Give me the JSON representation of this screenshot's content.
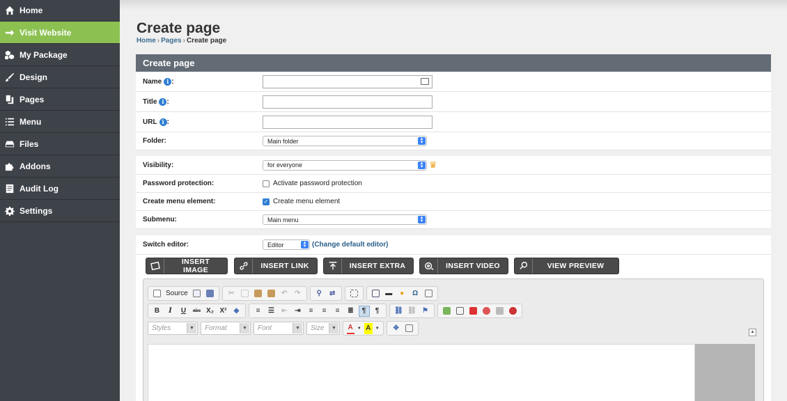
{
  "sidebar": {
    "items": [
      {
        "label": "Home",
        "icon": "home-icon"
      },
      {
        "label": "Visit Website",
        "icon": "arrow-right-icon",
        "active": true
      },
      {
        "label": "My Package",
        "icon": "cubes-icon"
      },
      {
        "label": "Design",
        "icon": "brush-icon"
      },
      {
        "label": "Pages",
        "icon": "copy-icon"
      },
      {
        "label": "Menu",
        "icon": "list-icon"
      },
      {
        "label": "Files",
        "icon": "drive-icon"
      },
      {
        "label": "Addons",
        "icon": "puzzle-icon"
      },
      {
        "label": "Audit Log",
        "icon": "document-icon"
      },
      {
        "label": "Settings",
        "icon": "gear-icon"
      }
    ],
    "active_color": "#8cc152",
    "bg_color": "#3e4249"
  },
  "header": {
    "title": "Create page",
    "breadcrumb": [
      "Home",
      "Pages",
      "Create page"
    ]
  },
  "panel": {
    "title": "Create page",
    "fields": {
      "name_label": "Name",
      "title_label": "Title",
      "url_label": "URL",
      "colon": ":",
      "folder_label": "Folder:",
      "folder_value": "Main folder",
      "visibility_label": "Visibility:",
      "visibility_value": "for everyone",
      "password_label": "Password protection:",
      "password_option": "Activate password protection",
      "password_checked": false,
      "menu_label": "Create menu element:",
      "menu_option": "Create menu element",
      "menu_checked": true,
      "submenu_label": "Submenu:",
      "submenu_value": "Main menu",
      "editor_label": "Switch editor:",
      "editor_value": "Editor",
      "editor_link": "(Change default editor)"
    },
    "insert_buttons": [
      {
        "label": "INSERT IMAGE",
        "icon": "image-icon"
      },
      {
        "label": "INSERT LINK",
        "icon": "link-icon"
      },
      {
        "label": "INSERT EXTRA",
        "icon": "upload-icon"
      },
      {
        "label": "INSERT VIDEO",
        "icon": "film-icon"
      },
      {
        "label": "VIEW PREVIEW",
        "icon": "search-icon"
      }
    ],
    "editor": {
      "source_label": "Source",
      "combos": [
        "Styles",
        "Format",
        "Font",
        "Size"
      ],
      "bold": "B",
      "italic": "I",
      "underline": "U",
      "strike": "abc",
      "subscript": "X₂",
      "superscript": "X²",
      "omega": "Ω",
      "text_color": "A",
      "bg_color": "A"
    }
  }
}
